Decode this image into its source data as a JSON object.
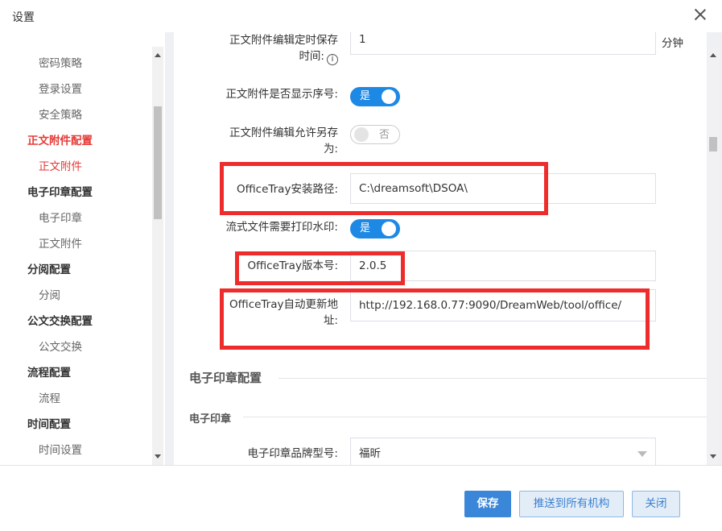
{
  "dialog": {
    "title": "设置"
  },
  "sidebar": {
    "items": [
      {
        "label": "密码策略",
        "kind": "sub"
      },
      {
        "label": "登录设置",
        "kind": "sub"
      },
      {
        "label": "安全策略",
        "kind": "sub"
      },
      {
        "label": "正文附件配置",
        "kind": "group",
        "active": true
      },
      {
        "label": "正文附件",
        "kind": "sub",
        "active": true
      },
      {
        "label": "电子印章配置",
        "kind": "group"
      },
      {
        "label": "电子印章",
        "kind": "sub"
      },
      {
        "label": "正文附件",
        "kind": "sub"
      },
      {
        "label": "分阅配置",
        "kind": "group"
      },
      {
        "label": "分阅",
        "kind": "sub"
      },
      {
        "label": "公文交换配置",
        "kind": "group"
      },
      {
        "label": "公文交换",
        "kind": "sub"
      },
      {
        "label": "流程配置",
        "kind": "group"
      },
      {
        "label": "流程",
        "kind": "sub"
      },
      {
        "label": "时间配置",
        "kind": "group"
      },
      {
        "label": "时间设置",
        "kind": "sub"
      }
    ]
  },
  "form": {
    "autosave": {
      "label_line1": "正文附件编辑定时保存",
      "label_line2": "时间:",
      "value": "1",
      "unit": "分钟"
    },
    "show_seq": {
      "label": "正文附件是否显示序号:",
      "toggle": "是",
      "on": true
    },
    "allow_saveas": {
      "label_line1": "正文附件编辑允许另存",
      "label_line2": "为:",
      "toggle": "否",
      "on": false
    },
    "officetray_path": {
      "label": "OfficeTray安装路径:",
      "value": "C:\\dreamsoft\\DSOA\\"
    },
    "watermark": {
      "label": "流式文件需要打印水印:",
      "toggle": "是",
      "on": true
    },
    "officetray_version": {
      "label": "OfficeTray版本号:",
      "value": "2.0.5"
    },
    "officetray_update": {
      "label_line1": "OfficeTray自动更新地",
      "label_line2": "址:",
      "value": "http://192.168.0.77:9090/DreamWeb/tool/office/"
    },
    "section_seal": "电子印章配置",
    "subsection_seal": "电子印章",
    "seal_brand": {
      "label": "电子印章品牌型号:",
      "value": "福昕"
    }
  },
  "footer": {
    "save": "保存",
    "push_all": "推送到所有机构",
    "close": "关闭"
  },
  "colors": {
    "accent": "#3a86d8",
    "active": "#e53935",
    "highlight": "#ee2c2c"
  }
}
